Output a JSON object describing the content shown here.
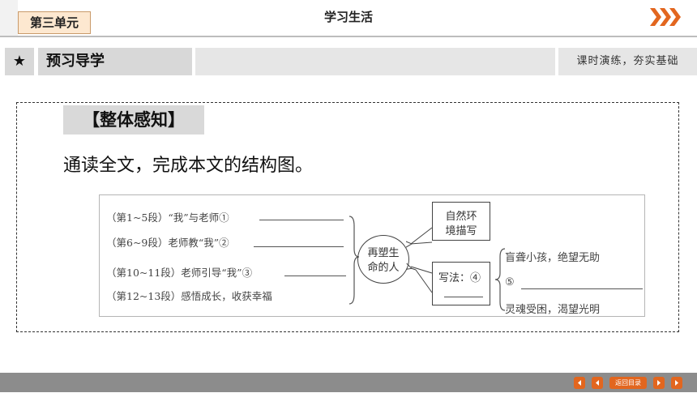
{
  "header": {
    "unit_label": "第三单元",
    "title": "学习生活"
  },
  "preview_bar": {
    "star": "★",
    "title": "预习导学",
    "slogan": "课时演练，夯实基础"
  },
  "section": {
    "tag": "【整体感知】",
    "instruction": "通读全文，完成本文的结构图。"
  },
  "diagram": {
    "items": [
      "（第1~5段）“我”与老师①",
      "（第6~9段）老师教“我”②",
      "（第10~11段）老师引导“我”③",
      "（第12~13段）感悟成长，收获幸福"
    ],
    "center": [
      "再塑生",
      "命的人"
    ],
    "env_box": [
      "自然环",
      "境描写"
    ],
    "method_box": "写法：④",
    "right_items": [
      "盲聋小孩，绝望无助",
      "⑤",
      "灵魂受困，渴望光明"
    ]
  },
  "footer": {
    "back_label": "返回目录"
  },
  "colors": {
    "accent": "#e2661f",
    "footer": "#8c8c8c",
    "bar": "#d8d8d8"
  }
}
